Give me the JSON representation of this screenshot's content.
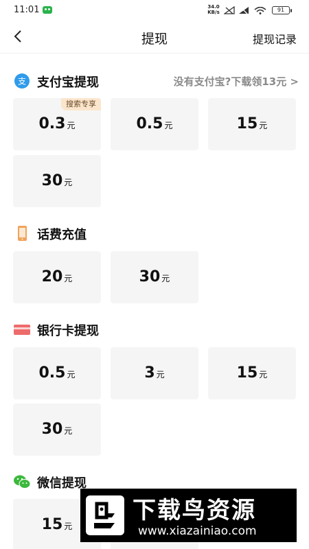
{
  "status_bar": {
    "time": "11:01",
    "net_speed_value": "34.0",
    "net_speed_unit": "KB/s",
    "battery": "91"
  },
  "header": {
    "back_icon": "chevron-left-icon",
    "title": "提现",
    "record_label": "提现记录"
  },
  "sections": {
    "alipay": {
      "icon": "alipay-icon",
      "title": "支付宝提现",
      "promo": "没有支付宝?下载领13元 >",
      "options": [
        {
          "amount": "0.3",
          "unit": "元",
          "tag": "搜索专享"
        },
        {
          "amount": "0.5",
          "unit": "元"
        },
        {
          "amount": "15",
          "unit": "元"
        },
        {
          "amount": "30",
          "unit": "元"
        }
      ]
    },
    "phone": {
      "icon": "phone-icon",
      "title": "话费充值",
      "options": [
        {
          "amount": "20",
          "unit": "元"
        },
        {
          "amount": "30",
          "unit": "元"
        }
      ]
    },
    "bank": {
      "icon": "bank-card-icon",
      "title": "银行卡提现",
      "options": [
        {
          "amount": "0.5",
          "unit": "元"
        },
        {
          "amount": "3",
          "unit": "元"
        },
        {
          "amount": "15",
          "unit": "元"
        },
        {
          "amount": "30",
          "unit": "元"
        }
      ]
    },
    "wechat": {
      "icon": "wechat-icon",
      "title": "微信提现",
      "options": [
        {
          "amount": "15",
          "unit": "元"
        }
      ]
    }
  },
  "watermark": {
    "title": "下载鸟资源",
    "url": "www.xiazainiao.com"
  },
  "colors": {
    "card_bg": "#f5f5f5",
    "tag_bg": "#fbe6cd",
    "alipay_blue": "#2f9bea",
    "phone_orange": "#f0a35a",
    "bank_red": "#ee6b6b",
    "wechat_green": "#3cb83c"
  }
}
